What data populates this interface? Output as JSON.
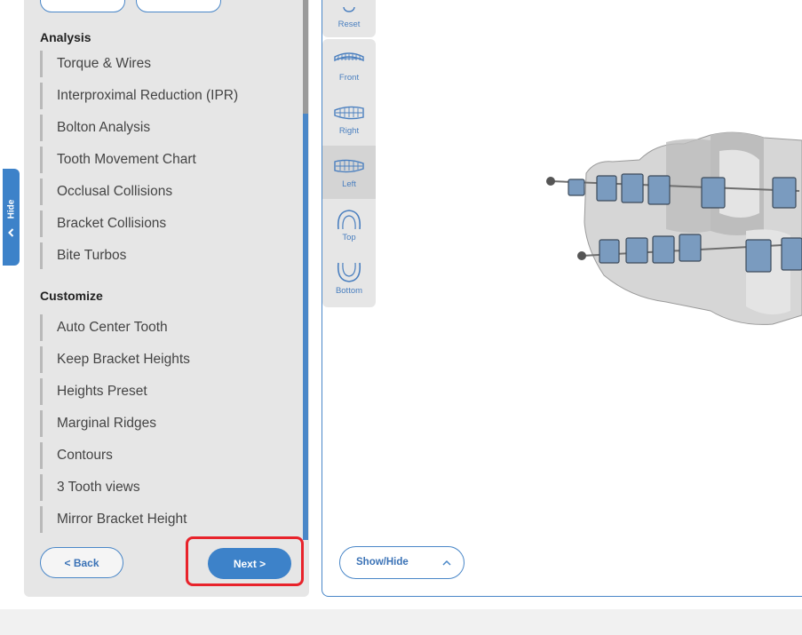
{
  "sidebar": {
    "hide_label": "Hide",
    "analysis": {
      "title": "Analysis",
      "items": [
        "Torque & Wires",
        "Interproximal Reduction (IPR)",
        "Bolton Analysis",
        "Tooth Movement Chart",
        "Occlusal Collisions",
        "Bracket Collisions",
        "Bite Turbos"
      ]
    },
    "customize": {
      "title": "Customize",
      "items": [
        "Auto Center Tooth",
        "Keep Bracket Heights",
        "Heights Preset",
        "Marginal Ridges",
        "Contours",
        "3 Tooth views",
        "Mirror Bracket Height"
      ]
    },
    "back_label": "<  Back",
    "next_label": "Next  >"
  },
  "view_toolbar": {
    "reset_label": "Reset",
    "views": [
      "Front",
      "Right",
      "Left",
      "Top",
      "Bottom"
    ],
    "active_view": "Left"
  },
  "viewer": {
    "show_hide_label": "Show/Hide"
  },
  "colors": {
    "accent": "#3d82c9",
    "highlight": "#e8232b",
    "panel_bg": "#e6e6e6"
  }
}
